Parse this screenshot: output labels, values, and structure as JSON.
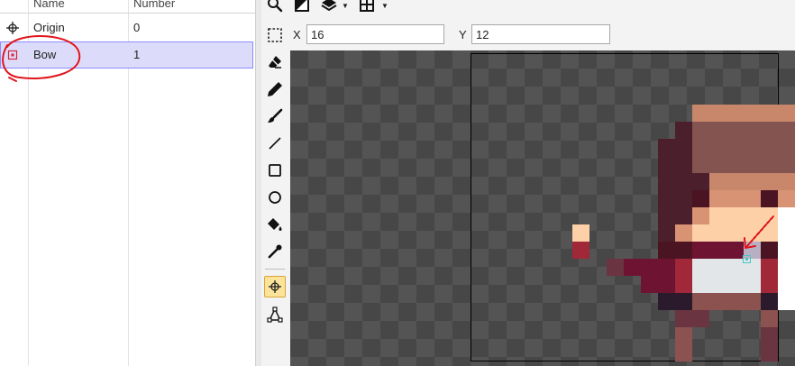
{
  "table": {
    "columns": [
      "Name",
      "Number"
    ],
    "rows": [
      {
        "icon": "origin-crosshair-icon",
        "name": "Origin",
        "number": "0"
      },
      {
        "icon": "point-square-icon",
        "name": "Bow",
        "number": "1"
      }
    ],
    "selected_row": 1
  },
  "toolbar": {
    "icons": [
      "search-icon",
      "contrast-icon",
      "layers-icon",
      "grid-icon"
    ]
  },
  "coords": {
    "x_label": "X",
    "x_value": "16",
    "y_label": "Y",
    "y_value": "12"
  },
  "tools": [
    "selection-icon",
    "eraser-icon",
    "pencil-icon",
    "brush-icon",
    "line-icon",
    "rectangle-icon",
    "ellipse-icon",
    "fill-bucket-icon",
    "eyedropper-icon",
    "point-tool-icon",
    "polygon-tool-icon"
  ],
  "active_tool": "point-tool-icon",
  "colors": {
    "selection_highlight": "#dcdcfa",
    "active_tool": "#fbe39a",
    "annotation_red": "#e0161b",
    "point_marker_cyan": "#46c8c8",
    "point_marker_red": "#d9233a"
  }
}
